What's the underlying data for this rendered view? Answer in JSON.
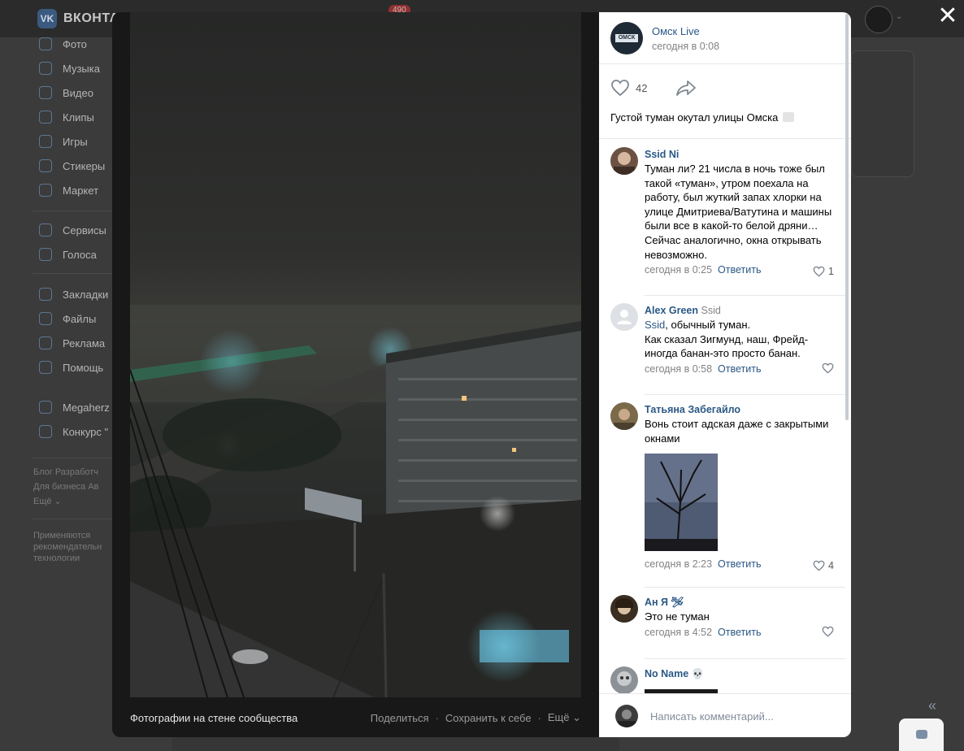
{
  "background": {
    "logo_short": "VK",
    "logo_text": "ВКОНТА",
    "badge": "490",
    "menu": [
      "Фото",
      "Музыка",
      "Видео",
      "Клипы",
      "Игры",
      "Стикеры",
      "Маркет",
      "Сервисы",
      "Голоса",
      "Закладки",
      "Файлы",
      "Реклама",
      "Помощь",
      "Megaherz",
      "Конкурс \""
    ],
    "footer_links": [
      "Блог   Разработч",
      "Для бизнеса   Ав",
      "Ещё ⌄"
    ],
    "footer_note": [
      "Применяются",
      "рекомендательн",
      "технологии"
    ],
    "collapse_glyph": "«"
  },
  "viewer": {
    "close_glyph": "✕",
    "caption": "Фотографии на стене сообщества",
    "share_label": "Поделиться",
    "save_label": "Сохранить к себе",
    "more_label": "Ещё ⌄",
    "separator": "·"
  },
  "post": {
    "group_avatar_tag": "ОМСК",
    "group_name": "Омск Live",
    "time": "сегодня в 0:08",
    "likes": "42",
    "text": "Густой туман окутал улицы Омска"
  },
  "comments": [
    {
      "name": "Ssid Ni",
      "text": "Туман ли? 21 числа в ночь тоже был такой «туман», утром поехала на работу, был жуткий запах хлорки на улице Дмитриева/Ватутина и машины были все в какой-то белой дряни…Сейчас аналогично, окна открывать невозможно.",
      "time": "сегодня в 0:25",
      "reply": "Ответить",
      "likes": "1"
    },
    {
      "name": "Alex Green",
      "reply_to": "Ssid",
      "mention": "Ssid",
      "text_after_mention": ", обычный туман.",
      "text_line2": "Как сказал Зигмунд, наш, Фрейд-иногда банан-это просто банан.",
      "time": "сегодня в 0:58",
      "reply": "Ответить",
      "likes": ""
    },
    {
      "name": "Татьяна Забегайло",
      "text": "Вонь стоит адская даже с закрытыми окнами",
      "time": "сегодня в 2:23",
      "reply": "Ответить",
      "likes": "4"
    },
    {
      "name": "Ан Я",
      "name_emoji": "🛩",
      "text": "Это не туман",
      "time": "сегодня в 4:52",
      "reply": "Ответить",
      "likes": ""
    },
    {
      "name": "No Name",
      "name_emoji": "💀"
    }
  ],
  "compose": {
    "placeholder": "Написать комментарий..."
  }
}
